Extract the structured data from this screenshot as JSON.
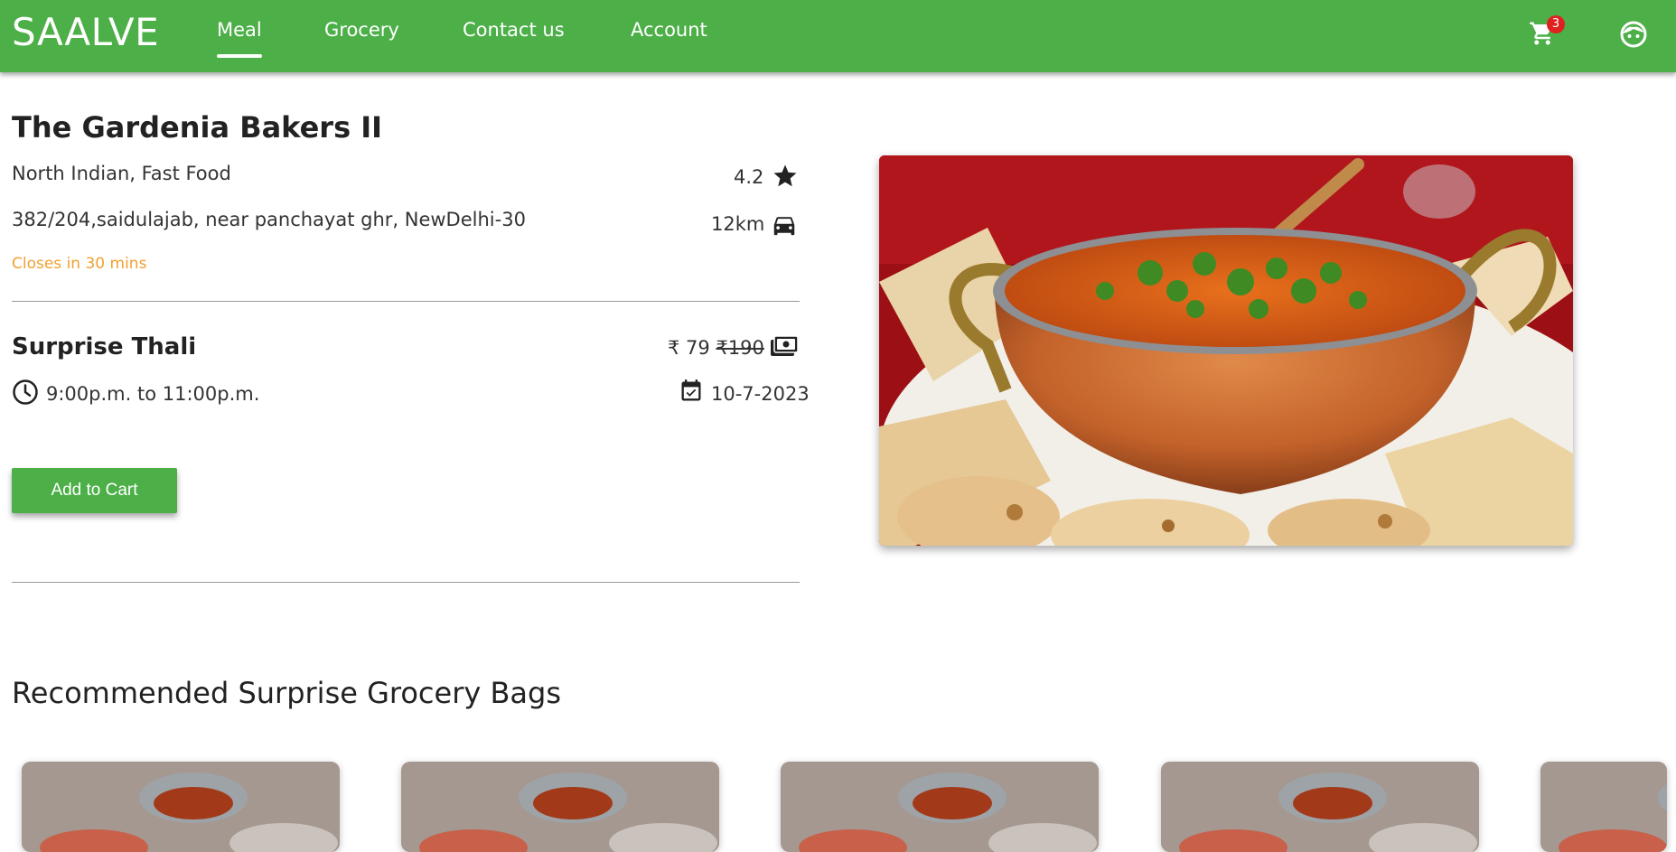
{
  "header": {
    "brand": "SAALVE",
    "nav": [
      {
        "label": "Meal",
        "active": true
      },
      {
        "label": "Grocery",
        "active": false
      },
      {
        "label": "Contact us",
        "active": false
      },
      {
        "label": "Account",
        "active": false
      }
    ],
    "cart_count": "3",
    "cart_icon": "shopping-cart-icon",
    "profile_icon": "face-icon",
    "brand_color": "#4caf47"
  },
  "store": {
    "name": "The Gardenia Bakers II",
    "cuisine": "North Indian, Fast Food",
    "address": "382/204,saidulajab, near panchayat ghr, NewDelhi-30",
    "closing_note": "Closes in 30 mins",
    "rating": "4.2",
    "distance": "12km"
  },
  "meal": {
    "name": "Surprise Thali",
    "price": "₹ 79",
    "original_price": "₹190",
    "pickup_time": "9:00p.m. to 11:00p.m.",
    "pickup_date": "10-7-2023",
    "add_to_cart_label": "Add to Cart"
  },
  "recommendations": {
    "title": "Recommended Surprise Grocery Bags",
    "card_count": 5
  },
  "colors": {
    "accent": "#4caf47",
    "closing_note": "#f0a030",
    "badge": "#e02020"
  }
}
